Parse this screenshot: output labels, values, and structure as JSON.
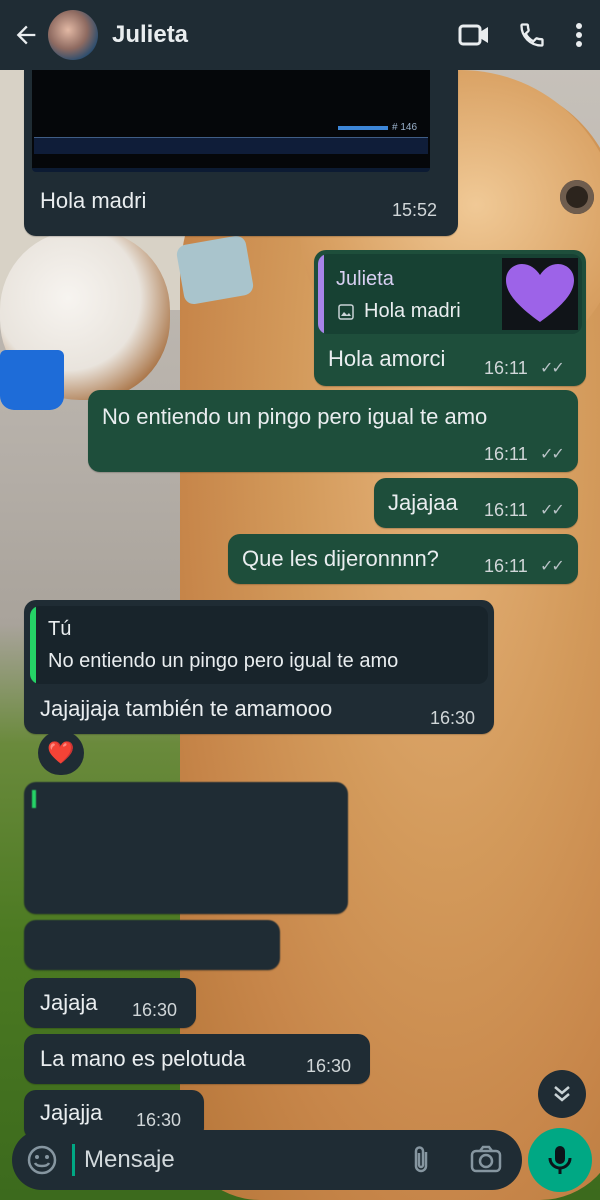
{
  "header": {
    "contact_name": "Julieta",
    "icons": [
      "back-arrow-icon",
      "video-call-icon",
      "phone-call-icon",
      "more-vert-icon"
    ]
  },
  "messages": {
    "m1": {
      "text": "Hola madri",
      "time": "15:52",
      "attachment_label": "# 146"
    },
    "m2": {
      "reply_name": "Julieta",
      "reply_text": "Hola madri",
      "text": "Hola amorci",
      "time": "16:11"
    },
    "m3": {
      "text": "No entiendo un pingo pero igual te amo",
      "time": "16:11"
    },
    "m4": {
      "text": "Jajajaa",
      "time": "16:11"
    },
    "m5": {
      "text": "Que les dijeronnnn?",
      "time": "16:11"
    },
    "m6": {
      "reply_name": "Tú",
      "reply_text": "No entiendo un pingo pero igual te amo",
      "text": "Jajajjaja también te amamooo",
      "time": "16:30",
      "reaction": "❤️"
    },
    "m9": {
      "text": "Jajaja",
      "time": "16:30"
    },
    "m10": {
      "text": "La mano es pelotuda",
      "time": "16:30"
    },
    "m11": {
      "text": "Jajajja",
      "time": "16:30"
    }
  },
  "input": {
    "placeholder": "Mensaje"
  },
  "colors": {
    "header_bg": "#1f2c34",
    "incoming": "#1f2c34",
    "outgoing": "#1e4e3b",
    "accent": "#00a884"
  }
}
